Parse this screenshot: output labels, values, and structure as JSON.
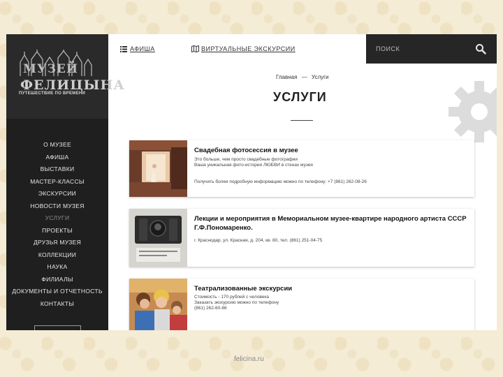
{
  "logo": {
    "name_line1": "МУЗЕЙ",
    "name_line2": "ФЕЛИЦЫНА",
    "tagline": "ПУТЕШЕСТВИЕ ПО ВРЕМЕНИ"
  },
  "sidebar": {
    "items": [
      {
        "label": "О МУЗЕЕ",
        "active": false
      },
      {
        "label": "АФИША",
        "active": false
      },
      {
        "label": "ВЫСТАВКИ",
        "active": false
      },
      {
        "label": "МАСТЕР-КЛАССЫ",
        "active": false
      },
      {
        "label": "ЭКСКУРСИИ",
        "active": false
      },
      {
        "label": "НОВОСТИ МУЗЕЯ",
        "active": false
      },
      {
        "label": "УСЛУГИ",
        "active": true
      },
      {
        "label": "ПРОЕКТЫ",
        "active": false
      },
      {
        "label": "ДРУЗЬЯ МУЗЕЯ",
        "active": false
      },
      {
        "label": "КОЛЛЕКЦИИ",
        "active": false
      },
      {
        "label": "НАУКА",
        "active": false
      },
      {
        "label": "ФИЛИАЛЫ",
        "active": false
      },
      {
        "label": "ДОКУМЕНТЫ И ОТЧЕТНОСТЬ",
        "active": false
      },
      {
        "label": "КОНТАКТЫ",
        "active": false
      }
    ]
  },
  "topbar": {
    "afisha_label": "АФИША",
    "tours_label": "ВИРТУАЛЬНЫЕ ЭКСКУРСИИ",
    "search_placeholder": "ПОИСК"
  },
  "breadcrumb": {
    "home": "Главная",
    "separator": "—",
    "current": "Услуги"
  },
  "page_title": "УСЛУГИ",
  "cards": [
    {
      "title": "Свадебная фотосессия в музее",
      "lines": [
        "Это больше, чем просто свадебные фотографии",
        "Ваша уникальная фото-история ЛЮБВИ в стенах музея",
        "Получить более подробную информацию можно по телефону: +7 (861) 262-08-26"
      ]
    },
    {
      "title": "Лекции и мероприятия в Мемориальном музее-квартире народного артиста СССР Г.Ф.Пономаренко.",
      "lines": [
        "г. Краснодар, ул. Красная, д. 204, кв. 80, тел. (861) 251-04-75"
      ]
    },
    {
      "title": "Театрализованные экскурсии",
      "lines": [
        "Стоимость - 170 рублей с человека",
        "Заказать экскурсию можно по телефону",
        "(861) 262-60-86"
      ]
    }
  ],
  "footer": {
    "site": "felicina.ru"
  },
  "colors": {
    "sidebar_bg": "#1f1f1f",
    "search_bg": "#262626",
    "slide_bg": "#f5ecd6",
    "gear": "#dcdcdc"
  }
}
